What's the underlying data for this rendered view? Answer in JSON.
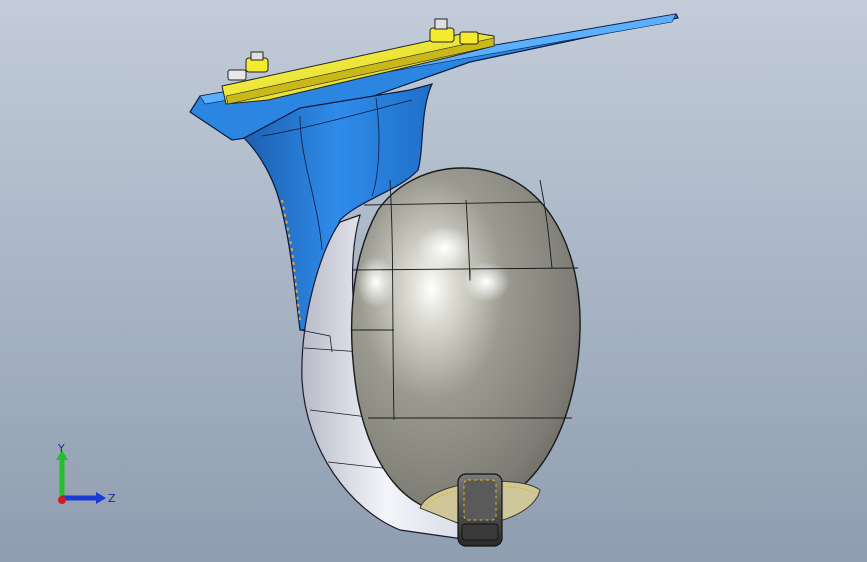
{
  "viewport": {
    "background_top": "#c3ccd8",
    "background_bottom": "#8f9db0"
  },
  "model": {
    "bracket_color": "#2a86e0",
    "mount_plate_color": "#f0e72a",
    "shell_color": "#8f8f86",
    "housing_color": "#e6e8f0",
    "lens_color": "#404040"
  },
  "triad": {
    "y_label": "Y",
    "z_label": "Z",
    "y_color": "#22c02a",
    "z_color": "#1a3ad8",
    "x_color": "#d81a1a"
  }
}
